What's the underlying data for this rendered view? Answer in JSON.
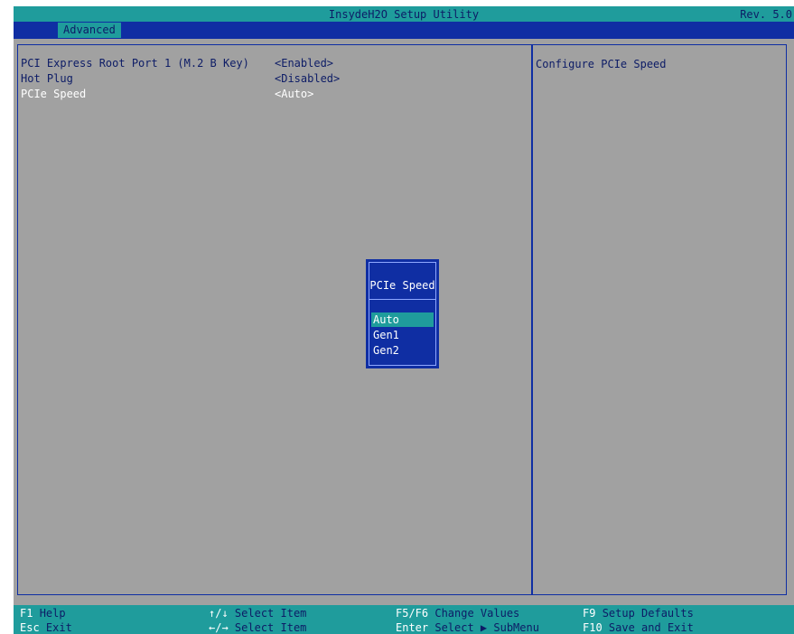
{
  "header": {
    "title": "InsydeH2O Setup Utility",
    "revision": "Rev. 5.0"
  },
  "tabs": [
    {
      "label": "Advanced"
    }
  ],
  "settings": [
    {
      "label": "PCI Express Root Port 1 (M.2 B Key)",
      "value": "<Enabled>"
    },
    {
      "label": "Hot Plug",
      "value": "<Disabled>"
    },
    {
      "label": "PCIe Speed",
      "value": "<Auto>"
    }
  ],
  "help": {
    "text": "Configure PCIe Speed"
  },
  "popup": {
    "title": "PCIe Speed",
    "options": [
      "Auto",
      "Gen1",
      "Gen2"
    ],
    "selected": "Auto"
  },
  "footer": {
    "keys": [
      {
        "key": "F1",
        "desc": "Help"
      },
      {
        "key": "Esc",
        "desc": "Exit"
      },
      {
        "key": "↑/↓",
        "desc": "Select Item"
      },
      {
        "key": "←/→",
        "desc": "Select Item"
      },
      {
        "key": "F5/F6",
        "desc": "Change Values"
      },
      {
        "key": "Enter",
        "desc": "Select ▶ SubMenu"
      },
      {
        "key": "F9",
        "desc": "Setup Defaults"
      },
      {
        "key": "F10",
        "desc": "Save and Exit"
      }
    ]
  },
  "colors": {
    "background": "#a1a1a1",
    "title_bar": "#1f9c9c",
    "tab_bar": "#0f2ea3",
    "text_dark": "#0d1c66",
    "text_highlight": "#ffffff"
  }
}
